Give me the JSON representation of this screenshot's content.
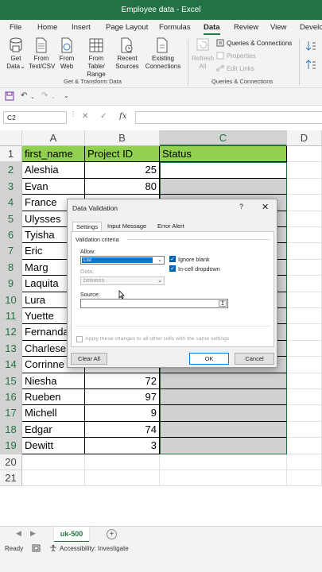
{
  "window": {
    "title": "Employee data  -  Excel"
  },
  "menu": {
    "tabs": [
      "File",
      "Home",
      "Insert",
      "Page Layout",
      "Formulas",
      "Data",
      "Review",
      "View",
      "Develo"
    ],
    "active": "Data"
  },
  "ribbon": {
    "get_data": "Get Data",
    "from_text": "From Text/CSV",
    "from_web": "From Web",
    "from_table": "From Table/ Range",
    "recent_sources": "Recent Sources",
    "existing_connections": "Existing Connections",
    "group_get_transform": "Get & Transform Data",
    "refresh_all": "Refresh All",
    "queries_connections": "Queries & Connections",
    "properties": "Properties",
    "edit_links": "Edit Links",
    "group_queries": "Queries & Connections"
  },
  "formula_bar": {
    "name_box": "C2",
    "fx": "fx",
    "value": ""
  },
  "grid": {
    "columns": [
      "A",
      "B",
      "C",
      "D"
    ],
    "selected_column": "C",
    "rows": [
      "1",
      "2",
      "3",
      "4",
      "5",
      "6",
      "7",
      "8",
      "9",
      "10",
      "11",
      "12",
      "13",
      "14",
      "15",
      "16",
      "17",
      "18",
      "19",
      "20",
      "21"
    ],
    "header": [
      "first_name",
      "Project ID",
      "Status"
    ],
    "data": [
      [
        "Aleshia",
        "25"
      ],
      [
        "Evan",
        "80"
      ],
      [
        "France",
        ""
      ],
      [
        "Ulysses",
        ""
      ],
      [
        "Tyisha",
        ""
      ],
      [
        "Eric",
        ""
      ],
      [
        "Marg",
        ""
      ],
      [
        "Laquita",
        ""
      ],
      [
        "Lura",
        ""
      ],
      [
        "Yuette",
        ""
      ],
      [
        "Fernanda",
        ""
      ],
      [
        "Charlese",
        ""
      ],
      [
        "Corrinne",
        ""
      ],
      [
        "Niesha",
        "72"
      ],
      [
        "Rueben",
        "97"
      ],
      [
        "Michell",
        "9"
      ],
      [
        "Edgar",
        "74"
      ],
      [
        "Dewitt",
        "3"
      ]
    ]
  },
  "sheet": {
    "active_tab": "uk-500"
  },
  "status": {
    "ready": "Ready",
    "accessibility": "Accessibility: Investigate"
  },
  "dialog": {
    "title": "Data Validation",
    "help": "?",
    "tabs": [
      "Settings",
      "Input Message",
      "Error Alert"
    ],
    "active_tab": "Settings",
    "section": "Validation criteria",
    "allow_label": "Allow:",
    "allow_value": "List",
    "data_label": "Data:",
    "data_value": "between",
    "ignore_blank": "Ignore blank",
    "in_cell_dropdown": "In-cell dropdown",
    "source_label": "Source:",
    "apply_all": "Apply these changes to all other cells with the same settings",
    "clear_all": "Clear All",
    "ok": "OK",
    "cancel": "Cancel"
  },
  "colors": {
    "excel_green": "#217346",
    "header_fill": "#92d050",
    "selection_blue": "#0078d7"
  }
}
